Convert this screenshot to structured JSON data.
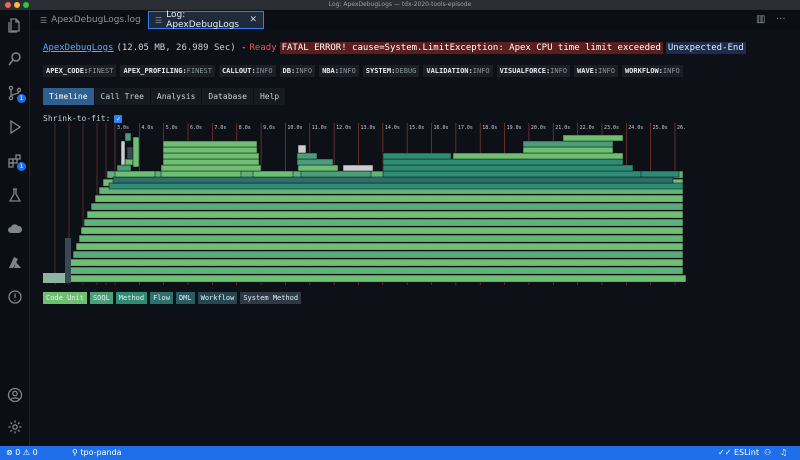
{
  "window": {
    "title": "Log: ApexDebugLogs — tdx-2020-tools-episode"
  },
  "tabs": [
    {
      "label": "ApexDebugLogs.log",
      "active": false
    },
    {
      "label": "Log: ApexDebugLogs",
      "active": true
    }
  ],
  "activity": {
    "badges": {
      "scm": "1",
      "extensions": "1"
    }
  },
  "header": {
    "log_name": "ApexDebugLogs",
    "meta": "(12.05 MB, 26.989 Sec) -",
    "status": "Ready",
    "error": "FATAL ERROR! cause=System.LimitException: Apex CPU time limit exceeded",
    "end_state": "Unexpected-End"
  },
  "debug_levels": [
    {
      "key": "APEX_CODE:",
      "value": "FINEST"
    },
    {
      "key": "APEX_PROFILING:",
      "value": "FINEST"
    },
    {
      "key": "CALLOUT:",
      "value": "INFO"
    },
    {
      "key": "DB:",
      "value": "INFO"
    },
    {
      "key": "NBA:",
      "value": "INFO"
    },
    {
      "key": "SYSTEM:",
      "value": "DEBUG"
    },
    {
      "key": "VALIDATION:",
      "value": "INFO"
    },
    {
      "key": "VISUALFORCE:",
      "value": "INFO"
    },
    {
      "key": "WAVE:",
      "value": "INFO"
    },
    {
      "key": "WORKFLOW:",
      "value": "INFO"
    }
  ],
  "view_tabs": [
    {
      "label": "Timeline",
      "active": true
    },
    {
      "label": "Call Tree",
      "active": false
    },
    {
      "label": "Analysis",
      "active": false
    },
    {
      "label": "Database",
      "active": false
    },
    {
      "label": "Help",
      "active": false
    }
  ],
  "shrink_to_fit": {
    "label": "Shrink-to-fit:",
    "checked": true
  },
  "timeline": {
    "tick_labels": [
      "3.0s",
      "4.0s",
      "5.0s",
      "6.0s",
      "7.0s",
      "8.0s",
      "9.0s",
      "10.0s",
      "11.0s",
      "12.0s",
      "13.0s",
      "14.0s",
      "15.0s",
      "16.0s",
      "17.0s",
      "18.0s",
      "19.0s",
      "20.0s",
      "21.0s",
      "22.0s",
      "23.0s",
      "24.0s",
      "25.0s",
      "26.0s"
    ]
  },
  "legend": [
    {
      "label": "Code Unit",
      "color": "#6fbf73"
    },
    {
      "label": "SOQL",
      "color": "#4a9e78"
    },
    {
      "label": "Method",
      "color": "#2e8b74"
    },
    {
      "label": "Flow",
      "color": "#2d6f6b"
    },
    {
      "label": "DML",
      "color": "#285c62"
    },
    {
      "label": "Workflow",
      "color": "#24484f"
    },
    {
      "label": "System Method",
      "color": "#2b3a45"
    }
  ],
  "status_bar": {
    "errors": "0",
    "warnings": "0",
    "org": "tpo-panda",
    "linter": "ESLint"
  }
}
